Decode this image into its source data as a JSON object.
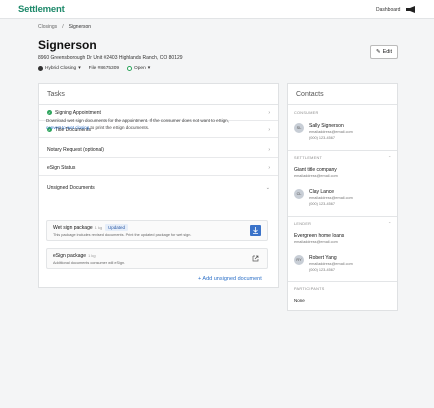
{
  "brand": "Settlement",
  "nav": {
    "dashboard": "Dashboard"
  },
  "breadcrumb": {
    "root": "Closings",
    "sep": "/",
    "current": "Signerson"
  },
  "header": {
    "title": "Signerson",
    "address": "8960 Greensborough Dr Unit #2403 Highlands Ranch, CO 80129",
    "closing_type": "Hybrid Closing",
    "file": "File #8675309",
    "status": "Open",
    "edit": "Edit"
  },
  "tasks": {
    "title": "Tasks",
    "rows": [
      {
        "label": "Signing Appointment",
        "done": true
      },
      {
        "label": "Title Documents",
        "done": true
      },
      {
        "label": "Notary Request (optional)",
        "done": false
      },
      {
        "label": "eSign Status",
        "done": false
      },
      {
        "label": "Unsigned Documents",
        "done": false
      }
    ],
    "unsigned_text1": "Download wet sign documents for the appointment. If the consumer does not want to eSign,",
    "unsigned_link": "convert to wet closing",
    "unsigned_text2": " to print the eSign documents.",
    "cards": [
      {
        "name": "Wet sign package",
        "size": "1 kg",
        "badge": "Updated",
        "desc": "This package includes revised documents. Print the updated package for wet sign."
      },
      {
        "name": "eSign package",
        "size": "1 kg",
        "badge": "",
        "desc": "Additional documents consumer will eSign."
      }
    ],
    "add_button": "+ Add unsigned document"
  },
  "contacts": {
    "title": "Contacts",
    "consumer_label": "CONSUMER",
    "consumer": {
      "initials": "SL",
      "name": "Sally Signerson",
      "email": "emailaddress@email.com",
      "phone": "(000) 123-4567"
    },
    "settlement_label": "SETTLEMENT",
    "settlement_company": "Giant title company",
    "settlement_email": "emailaddress@email.com",
    "settlement_person": {
      "initials": "CL",
      "name": "Clay Lance",
      "email": "emailaddress@email.com",
      "phone": "(000) 123-4567"
    },
    "lender_label": "LENDER",
    "lender_company": "Evergreen home loans",
    "lender_email": "emailaddress@email.com",
    "lender_person": {
      "initials": "RY",
      "name": "Robert Yang",
      "email": "emailaddress@email.com",
      "phone": "(000) 123-4567"
    },
    "participants_label": "PARTICIPANTS",
    "participants_value": "None"
  },
  "colors": {
    "brand": "#1f8a6b",
    "check": "#2aa35a",
    "link": "#2b6fc7"
  }
}
